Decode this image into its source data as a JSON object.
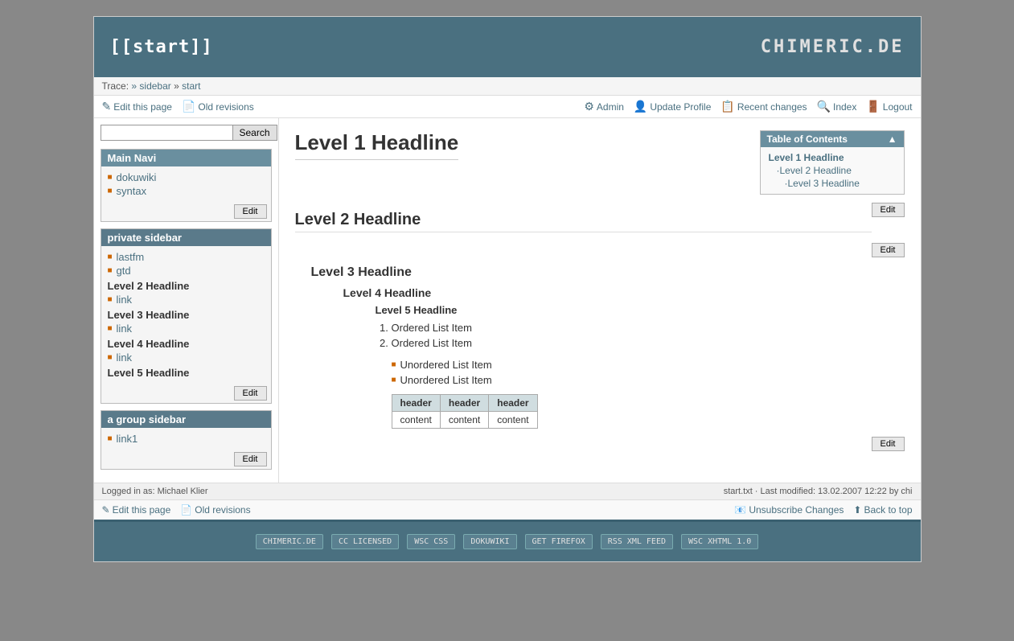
{
  "header": {
    "title": "[[start]]",
    "brand": "CHIMERIC.DE"
  },
  "breadcrumb": {
    "trace_label": "Trace:",
    "items": [
      {
        "label": "»",
        "href": "#"
      },
      {
        "label": "sidebar",
        "href": "#"
      },
      {
        "label": "»",
        "href": null
      },
      {
        "label": "start",
        "href": "#"
      }
    ]
  },
  "toolbar": {
    "edit_page": "Edit this page",
    "old_revisions": "Old revisions",
    "admin": "Admin",
    "update_profile": "Update Profile",
    "recent_changes": "Recent changes",
    "index": "Index",
    "logout": "Logout"
  },
  "sidebar": {
    "search_placeholder": "",
    "search_button": "Search",
    "sections": [
      {
        "id": "main-navi",
        "title": "Main Navi",
        "items": [
          {
            "label": "dokuwiki",
            "href": "#"
          },
          {
            "label": "syntax",
            "href": "#"
          }
        ],
        "edit_btn": "Edit"
      },
      {
        "id": "private-sidebar",
        "title": "private sidebar",
        "items": [
          {
            "label": "lastfm",
            "href": "#",
            "type": "link"
          },
          {
            "label": "gtd",
            "href": "#",
            "type": "link"
          }
        ],
        "headings": [
          {
            "label": "Level 2 Headline",
            "links": [
              {
                "label": "link",
                "href": "#"
              }
            ]
          },
          {
            "label": "Level 3 Headline",
            "links": [
              {
                "label": "link",
                "href": "#"
              }
            ]
          },
          {
            "label": "Level 4 Headline",
            "links": [
              {
                "label": "link",
                "href": "#"
              }
            ]
          },
          {
            "label": "Level 5 Headline",
            "links": []
          }
        ],
        "edit_btn": "Edit"
      },
      {
        "id": "a-group-sidebar",
        "title": "a group sidebar",
        "items": [
          {
            "label": "link1",
            "href": "#"
          }
        ],
        "edit_btn": "Edit"
      }
    ]
  },
  "toc": {
    "title": "Table of Contents",
    "items": [
      {
        "label": "Level 1 Headline",
        "level": 1,
        "href": "#"
      },
      {
        "label": "Level 2 Headline",
        "level": 2,
        "href": "#"
      },
      {
        "label": "Level 3 Headline",
        "level": 3,
        "href": "#"
      }
    ]
  },
  "content": {
    "h1": "Level 1 Headline",
    "h2": "Level 2 Headline",
    "h2_edit": "Edit",
    "h3": "Level 3 Headline",
    "h3_edit": "Edit",
    "h4": "Level 4 Headline",
    "h5": "Level 5 Headline",
    "ordered_list": [
      "Ordered List Item",
      "Ordered List Item"
    ],
    "unordered_list": [
      "Unordered List Item",
      "Unordered List Item"
    ],
    "table": {
      "headers": [
        "header",
        "header",
        "header"
      ],
      "rows": [
        [
          "content",
          "content",
          "content"
        ]
      ]
    },
    "bottom_edit": "Edit"
  },
  "info_bar": {
    "logged_in": "Logged in as: Michael Klier",
    "file_info": "start.txt · Last modified: 13.02.2007 12:22 by chi"
  },
  "bottom_toolbar": {
    "edit_page": "Edit this page",
    "old_revisions": "Old revisions",
    "unsubscribe": "Unsubscribe Changes",
    "back_to_top": "Back to top"
  },
  "footer": {
    "badges": [
      "CHIMERIC.DE",
      "CC LICENSED",
      "WSC CSS",
      "DOKUWIKI",
      "GET FIREFOX",
      "RSS XML FEED",
      "WSC XHTML 1.0"
    ]
  }
}
